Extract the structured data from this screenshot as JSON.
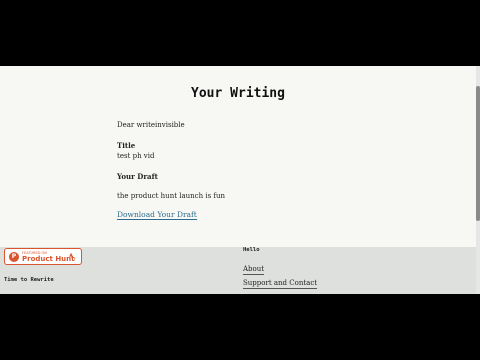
{
  "page": {
    "title": "Your Writing",
    "greeting": "Dear writeinvisible",
    "title_label": "Title",
    "title_value": "test ph vid",
    "draft_label": "Your Draft",
    "draft_text": "the product hunt launch is fun",
    "download_link": "Download Your Draft"
  },
  "footer": {
    "badge": {
      "small_text": "FEATURED ON",
      "label": "Product Hunt",
      "arrow": "▲",
      "count": "0"
    },
    "tagline": "Time to Rewrite",
    "heading": "Hello",
    "links": [
      "About",
      "Support and Contact"
    ]
  },
  "colors": {
    "background": "#f7f8f4",
    "footer": "#dde0dd",
    "link": "#2d6c8f",
    "product_hunt": "#da552f"
  }
}
